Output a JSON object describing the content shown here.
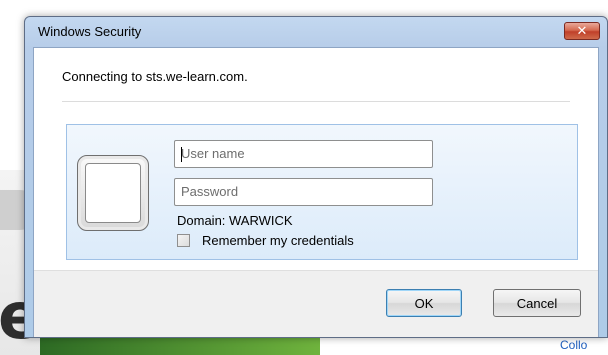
{
  "background": {
    "letter": "e",
    "link_text": "Collo"
  },
  "window": {
    "title": "Windows Security",
    "close_glyph": "✕"
  },
  "dialog": {
    "message": "Connecting to sts.we-learn.com.",
    "username_placeholder": "User name",
    "password_placeholder": "Password",
    "domain_text": "Domain: WARWICK",
    "remember_label": "Remember my credentials",
    "remember_checked": false
  },
  "buttons": {
    "ok": "OK",
    "cancel": "Cancel"
  },
  "colors": {
    "frame": "#b7cde9",
    "close": "#c0402a",
    "panel": "#dcebfa"
  }
}
